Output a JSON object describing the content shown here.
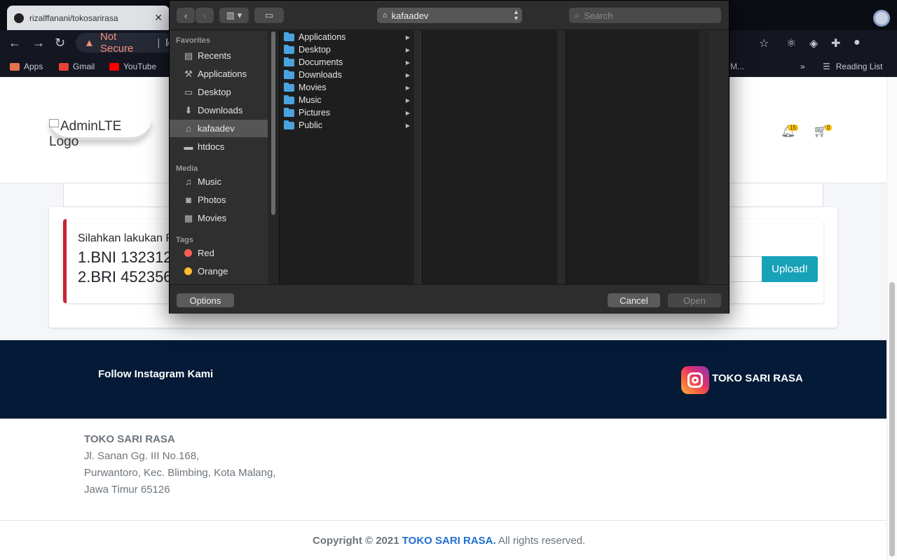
{
  "browser": {
    "tab_title": "rizalffanani/tokosarirasa",
    "tab_close": "✕",
    "security_label": "Not Secure",
    "url_fragment": "lo",
    "nav": {
      "back": "←",
      "forward": "→",
      "reload": "↻"
    },
    "star": "☆",
    "bookmarks": [
      {
        "label": "Apps",
        "icon": "apps-grid-icon",
        "color": "#e5734b"
      },
      {
        "label": "Gmail",
        "icon": "gmail-icon",
        "color": "#ea4335"
      },
      {
        "label": "YouTube",
        "icon": "youtube-icon",
        "color": "#ff0000"
      }
    ],
    "bookmarks_overflow": "»",
    "truncated_bookmark": "M...",
    "reading_list": "Reading List"
  },
  "page": {
    "logo_alt": "AdminLTE Logo",
    "notification_count": "15",
    "cart_count": "0",
    "payment_intro": "Silahkan lakukan Pe",
    "accounts": [
      "1.BNI 132312",
      "2.BRI 452356"
    ],
    "upload_button": "Upload!",
    "footer": {
      "follow": "Follow Instagram Kami",
      "instagram_label": "TOKO SARI RASA",
      "address": [
        "TOKO SARI RASA",
        "Jl. Sanan Gg. III No.168,",
        "Purwantoro, Kec. Blimbing, Kota Malang,",
        "Jawa Timur 65126"
      ],
      "copyright_prefix": "Copyright © 2021",
      "copyright_brand": "TOKO SARI RASA.",
      "copyright_suffix": "All rights reserved."
    }
  },
  "dialog": {
    "nav_back": "‹",
    "nav_forward": "›",
    "view_mode": "▥ ▾",
    "new_folder": "📁",
    "location": "kafaadev",
    "search_placeholder": "Search",
    "sidebar": {
      "favorites_heading": "Favorites",
      "favorites": [
        {
          "label": "Recents",
          "icon": "recents-icon",
          "glyph": "▤"
        },
        {
          "label": "Applications",
          "icon": "applications-icon",
          "glyph": "⚒"
        },
        {
          "label": "Desktop",
          "icon": "desktop-icon",
          "glyph": "▭"
        },
        {
          "label": "Downloads",
          "icon": "downloads-icon",
          "glyph": "⬇"
        },
        {
          "label": "kafaadev",
          "icon": "home-icon",
          "glyph": "⌂"
        },
        {
          "label": "htdocs",
          "icon": "folder-icon",
          "glyph": "▬"
        }
      ],
      "media_heading": "Media",
      "media": [
        {
          "label": "Music",
          "icon": "music-icon",
          "glyph": "♫"
        },
        {
          "label": "Photos",
          "icon": "camera-icon",
          "glyph": "◙"
        },
        {
          "label": "Movies",
          "icon": "film-icon",
          "glyph": "▦"
        }
      ],
      "tags_heading": "Tags",
      "tags": [
        {
          "label": "Red",
          "color": "#ff5f57"
        },
        {
          "label": "Orange",
          "color": "#febc2e"
        }
      ]
    },
    "folders": [
      "Applications",
      "Desktop",
      "Documents",
      "Downloads",
      "Movies",
      "Music",
      "Pictures",
      "Public"
    ],
    "options_button": "Options",
    "cancel_button": "Cancel",
    "open_button": "Open"
  }
}
